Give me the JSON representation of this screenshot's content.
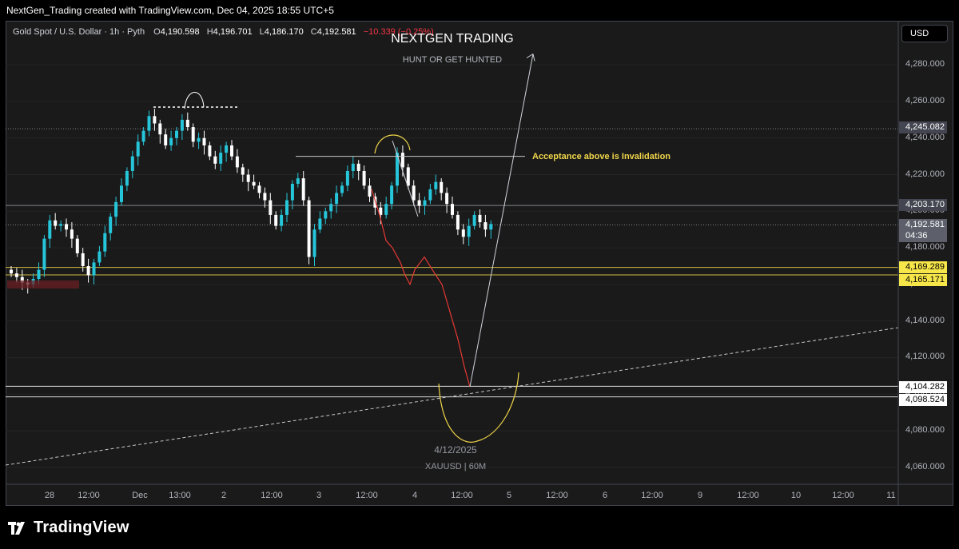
{
  "header": {
    "caption": "NextGen_Trading created with TradingView.com, Dec 04, 2025 18:55 UTC+5"
  },
  "legend": {
    "symbol": "Gold Spot / U.S. Dollar · 1h · Pyth",
    "o_label": "O",
    "o_value": "4,190.598",
    "h_label": "H",
    "h_value": "4,196.701",
    "l_label": "L",
    "l_value": "4,186.170",
    "c_label": "C",
    "c_value": "4,192.581",
    "change": "−10.339 (−0.25%)"
  },
  "currency_button": "USD",
  "annotations": {
    "title": "NEXTGEN TRADING",
    "subtitle": "HUNT OR GET HUNTED",
    "invalidation_note": "Acceptance above is Invalidation",
    "date_note": "4/12/2025",
    "symbol_note": "XAUUSD | 60M"
  },
  "price_badges": {
    "b4245": "4,245.082",
    "b4203": "4,203.170",
    "b4192": "4,192.581",
    "countdown": "04:36",
    "b4169": "4,169.289",
    "b4165": "4,165.171",
    "b4104": "4,104.282",
    "b4098": "4,098.524"
  },
  "footer": {
    "brand": "TradingView"
  },
  "colors": {
    "up": "#26c6da",
    "down": "#ffffff",
    "projection": "#e53935",
    "zone": "#f0d64a"
  },
  "chart_data": {
    "type": "candlestick",
    "symbol": "XAUUSD",
    "timeframe": "1h",
    "ylim": [
      4050,
      4300
    ],
    "y_ticks": [
      4060,
      4080,
      4100,
      4120,
      4140,
      4160,
      4180,
      4200,
      4220,
      4240,
      4260,
      4280
    ],
    "y_tick_labels": [
      "4,060.000",
      "4,080.000",
      "4,100.000",
      "4,120.000",
      "4,140.000",
      "4,160.000",
      "4,180.000",
      "4,200.000",
      "4,220.000",
      "4,240.000",
      "4,260.000",
      "4,280.000"
    ],
    "x_ticks": [
      "28",
      "12:00",
      "Dec",
      "13:00",
      "2",
      "12:00",
      "3",
      "12:00",
      "4",
      "12:00",
      "5",
      "12:00",
      "6",
      "12:00",
      "9",
      "12:00",
      "10",
      "12:00",
      "11"
    ],
    "closes": [
      4166,
      4164,
      4161,
      4160,
      4163,
      4168,
      4185,
      4195,
      4192,
      4193,
      4190,
      4185,
      4177,
      4170,
      4165,
      4172,
      4178,
      4188,
      4197,
      4205,
      4214,
      4222,
      4230,
      4238,
      4244,
      4252,
      4248,
      4242,
      4236,
      4240,
      4244,
      4250,
      4246,
      4238,
      4240,
      4236,
      4230,
      4226,
      4232,
      4236,
      4230,
      4224,
      4220,
      4216,
      4214,
      4210,
      4206,
      4198,
      4192,
      4198,
      4206,
      4215,
      4218,
      4206,
      4175,
      4190,
      4196,
      4200,
      4204,
      4210,
      4214,
      4222,
      4226,
      4222,
      4214,
      4208,
      4202,
      4198,
      4204,
      4214,
      4232,
      4224,
      4214,
      4206,
      4203,
      4206,
      4212,
      4216,
      4210,
      4204,
      4198,
      4190,
      4186,
      4192,
      4198,
      4194,
      4190,
      4193
    ],
    "horizontal_levels": [
      4245.082,
      4203.17,
      4192.581,
      4169.289,
      4165.171,
      4104.282,
      4098.524
    ],
    "resistance_level": 4230,
    "projection_path": [
      4212,
      4198,
      4184,
      4180,
      4172,
      4165,
      4160,
      4168,
      4175,
      4168,
      4160,
      4145,
      4130,
      4115,
      4104
    ],
    "target_arrow": [
      4104,
      4286
    ]
  }
}
